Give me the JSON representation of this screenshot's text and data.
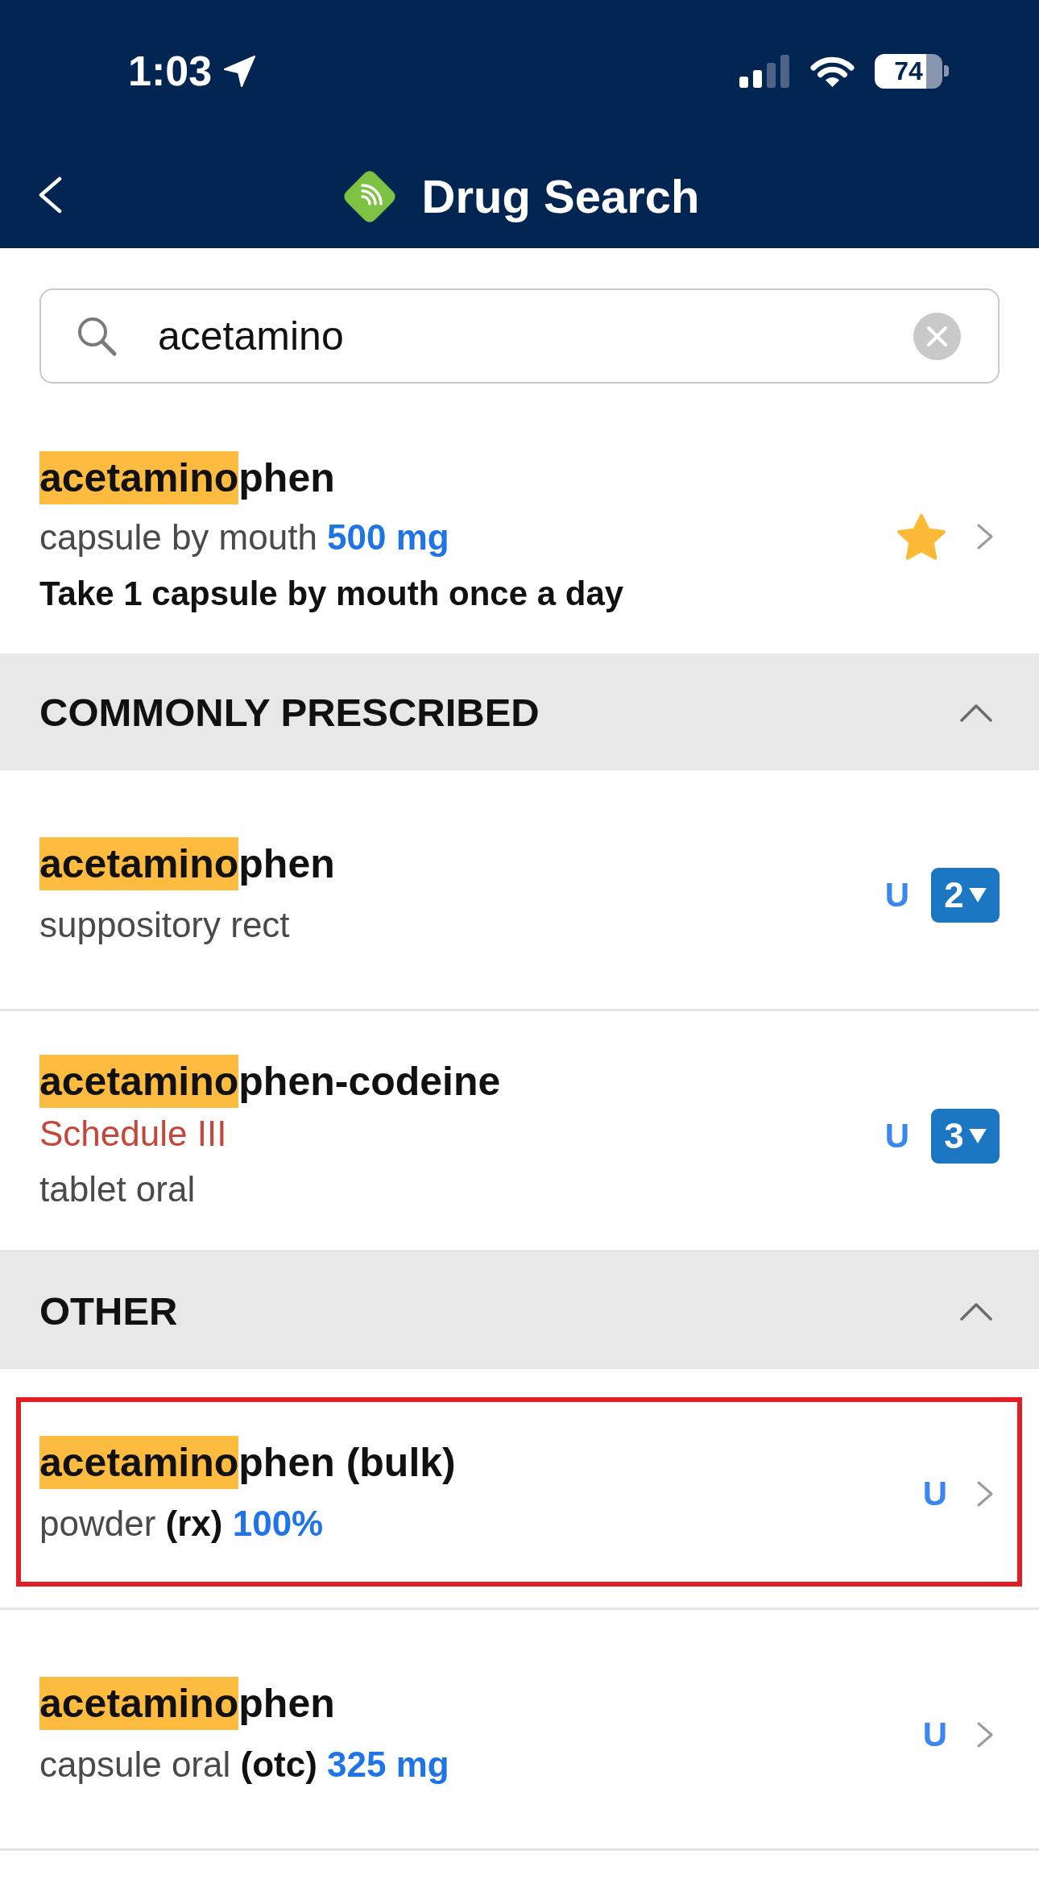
{
  "status_bar": {
    "time": "1:03",
    "battery": "74"
  },
  "header": {
    "title": "Drug Search"
  },
  "search": {
    "value": "acetamino"
  },
  "recent_item": {
    "name_match": "acetamino",
    "name_rest": "phen",
    "details": [
      {
        "kind": "form",
        "text": "capsule by mouth"
      },
      {
        "kind": "strength",
        "text": "500 mg"
      }
    ],
    "instruction": "Take 1 capsule by mouth once a day",
    "favorite": true
  },
  "sections": [
    {
      "title": "COMMONLY PRESCRIBED",
      "expanded": true,
      "items": [
        {
          "kind": "tier",
          "name_match": "acetamino",
          "name_rest": "phen",
          "details": [
            {
              "kind": "form",
              "text": "suppository rect"
            }
          ],
          "flag": "U",
          "tier": "2",
          "outlined": false
        },
        {
          "kind": "tier",
          "name_match": "acetamino",
          "name_rest": "phen-codeine",
          "schedule": "Schedule III",
          "details": [
            {
              "kind": "form",
              "text": "tablet oral"
            }
          ],
          "flag": "U",
          "tier": "3",
          "outlined": false
        }
      ]
    },
    {
      "title": "OTHER",
      "expanded": true,
      "items": [
        {
          "kind": "link",
          "name_match": "acetamino",
          "name_rest": "phen (bulk)",
          "details": [
            {
              "kind": "form",
              "text": "powder"
            },
            {
              "kind": "tag",
              "text": "(rx)"
            },
            {
              "kind": "strength",
              "text": "100%"
            }
          ],
          "flag": "U",
          "outlined": true
        },
        {
          "kind": "link",
          "name_match": "acetamino",
          "name_rest": "phen",
          "details": [
            {
              "kind": "form",
              "text": "capsule oral"
            },
            {
              "kind": "tag",
              "text": "(otc)"
            },
            {
              "kind": "strength",
              "text": "325 mg"
            }
          ],
          "flag": "U",
          "outlined": false
        }
      ]
    }
  ]
}
